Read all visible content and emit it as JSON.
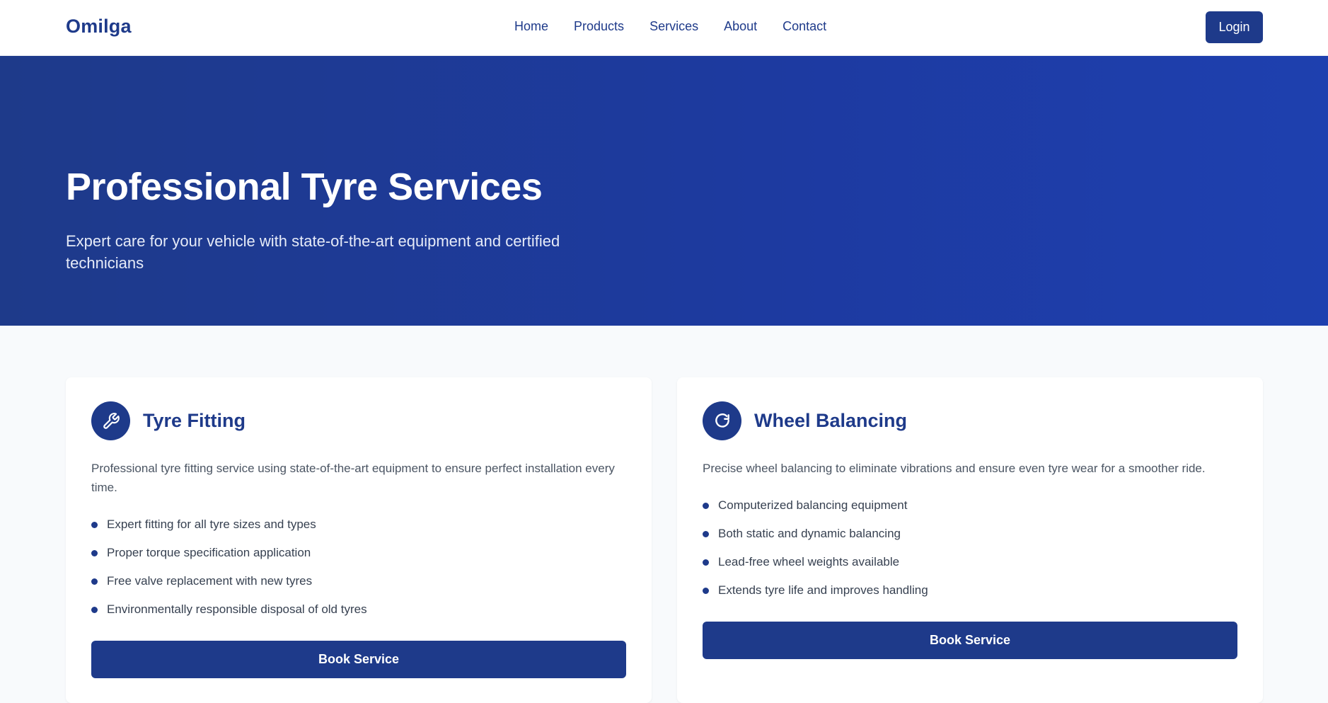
{
  "header": {
    "brand": "Omilga",
    "nav": [
      "Home",
      "Products",
      "Services",
      "About",
      "Contact"
    ],
    "login_label": "Login"
  },
  "hero": {
    "title": "Professional Tyre Services",
    "subtitle": "Expert care for your vehicle with state-of-the-art equipment and certified technicians"
  },
  "services": [
    {
      "icon": "wrench-icon",
      "title": "Tyre Fitting",
      "description": "Professional tyre fitting service using state-of-the-art equipment to ensure perfect installation every time.",
      "features": [
        "Expert fitting for all tyre sizes and types",
        "Proper torque specification application",
        "Free valve replacement with new tyres",
        "Environmentally responsible disposal of old tyres"
      ],
      "button_label": "Book Service"
    },
    {
      "icon": "refresh-icon",
      "title": "Wheel Balancing",
      "description": "Precise wheel balancing to eliminate vibrations and ensure even tyre wear for a smoother ride.",
      "features": [
        "Computerized balancing equipment",
        "Both static and dynamic balancing",
        "Lead-free wheel weights available",
        "Extends tyre life and improves handling"
      ],
      "button_label": "Book Service"
    }
  ],
  "colors": {
    "primary": "#1e3a8a",
    "page_background": "#f8fafc"
  }
}
